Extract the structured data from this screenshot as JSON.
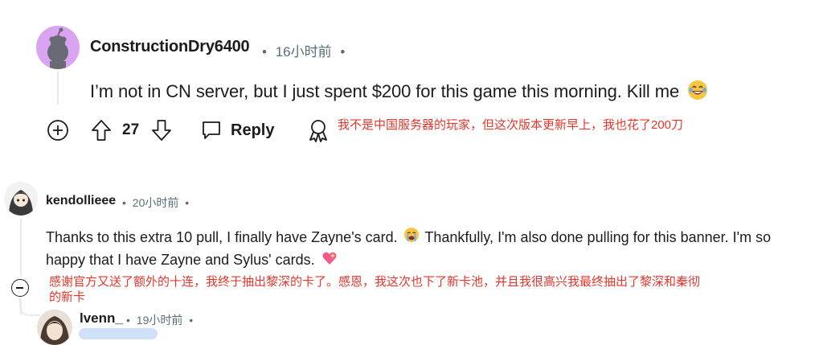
{
  "comments": [
    {
      "author": "ConstructionDry6400",
      "time": "16小时前",
      "body": "I’m not in CN server, but I just spent $200 for this game this morning. Kill me",
      "vote_count": "27",
      "reply_label": "Reply",
      "translation": "我不是中国服务器的玩家，但这次版本更新早上，我也花了200刀"
    },
    {
      "author": "kendollieee",
      "time": "20小时前",
      "body_part1": "Thanks to this extra 10 pull, I finally have Zayne's card.",
      "body_part2": " Thankfully, I'm also done pulling for this banner. I'm so happy that I have Zayne and Sylus' cards.",
      "translation": "感谢官方又送了额外的十连，我终于抽出黎深的卡了。感恩，我这次也下了新卡池，并且我很高兴我最终抽出了黎深和秦彻的新卡"
    },
    {
      "author": "lvenn_",
      "time": "19小时前"
    }
  ],
  "separator": "•",
  "icons": {
    "add": "add-circle-icon",
    "upvote": "upvote-arrow-icon",
    "downvote": "downvote-arrow-icon",
    "reply": "comment-bubble-icon",
    "award": "award-icon",
    "collapse": "collapse-minus-icon"
  },
  "colors": {
    "translation": "#e8362b",
    "meta": "#576f76",
    "avatar1_bg": "#d9a5f2"
  }
}
